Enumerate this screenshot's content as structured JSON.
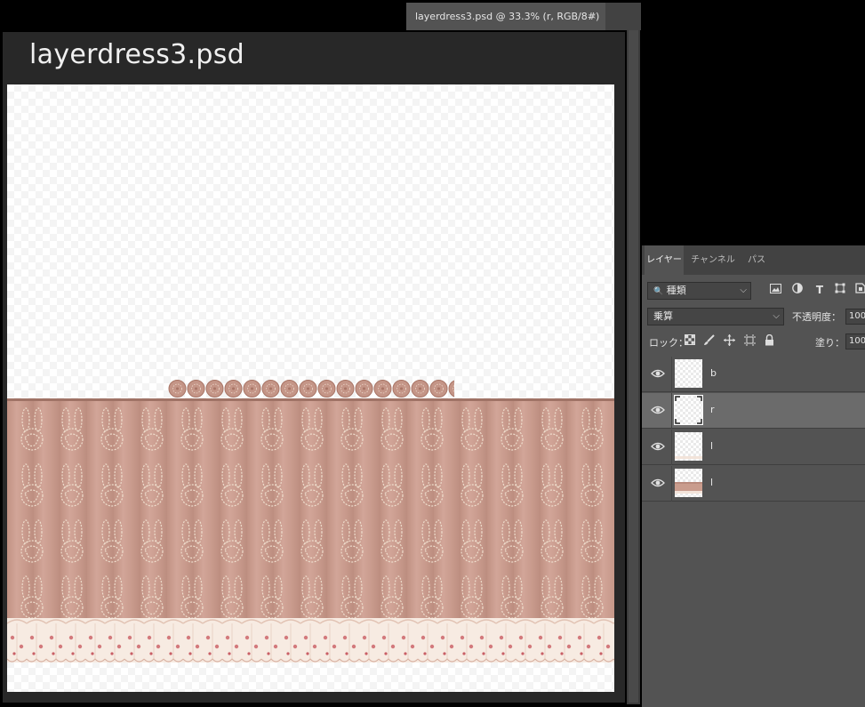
{
  "document_tab": {
    "label": "layerdress3.psd @ 33.3% (r, RGB/8#)",
    "close": "×"
  },
  "window": {
    "title": "layerdress3.psd"
  },
  "layers_panel": {
    "tabs": [
      {
        "label": "レイヤー",
        "active": true
      },
      {
        "label": "チャンネル",
        "active": false
      },
      {
        "label": "パス",
        "active": false
      }
    ],
    "filter": {
      "search_glyph": "🔍",
      "label": "種類"
    },
    "filter_icons": [
      "image-filter-icon",
      "adjustment-filter-icon",
      "type-filter-icon",
      "shape-filter-icon",
      "smart-object-filter-icon"
    ],
    "blend_mode": "乗算",
    "opacity_label": "不透明度：",
    "opacity_value": "100",
    "lock_label": "ロック：",
    "lock_icons": [
      "lock-transparent-icon",
      "lock-image-icon",
      "lock-position-icon",
      "lock-artboard-icon",
      "lock-all-icon"
    ],
    "fill_label": "塗り：",
    "fill_value": "100",
    "layers": [
      {
        "name": "b",
        "visible": true,
        "selected": false
      },
      {
        "name": "r",
        "visible": true,
        "selected": true
      },
      {
        "name": "l",
        "visible": true,
        "selected": false
      },
      {
        "name": "l",
        "visible": true,
        "selected": false
      }
    ]
  },
  "colors": {
    "skirt": "#c99c8d",
    "skirt_dark": "#a97b6d",
    "bunny_line": "#eddccb",
    "frill": "#f6e8de",
    "rose": "#d47f80",
    "waistband": "#b78d83"
  }
}
